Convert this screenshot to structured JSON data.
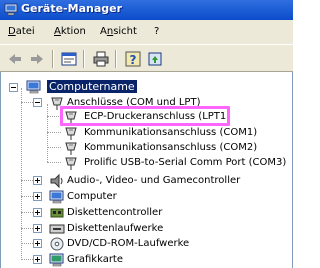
{
  "window": {
    "title": "Geräte-Manager"
  },
  "menu": [
    {
      "label": "Datei",
      "accel": "D"
    },
    {
      "label": "Aktion",
      "accel": "A"
    },
    {
      "label": "Ansicht",
      "accel": "n"
    },
    {
      "label": "?",
      "accel": ""
    }
  ],
  "toolbar": {
    "buttons": [
      "back-icon",
      "forward-icon",
      "properties-icon",
      "print-icon",
      "help-icon",
      "update-driver-icon"
    ]
  },
  "tree": {
    "root": "Computername",
    "ports_group": "Anschlüsse (COM und LPT)",
    "ports": [
      "ECP-Druckeranschluss (LPT1)",
      "Kommunikationsanschluss (COM1)",
      "Kommunikationsanschluss (COM2)",
      "Prolific USB-to-Serial Comm Port (COM3)"
    ],
    "categories": [
      "Audio-, Video- und Gamecontroller",
      "Computer",
      "Diskettencontroller",
      "Diskettenlaufwerke",
      "DVD/CD-ROM-Laufwerke",
      "Grafikkarte"
    ]
  },
  "highlight_color": "#ff66ff",
  "selection_color": "#0a246a"
}
